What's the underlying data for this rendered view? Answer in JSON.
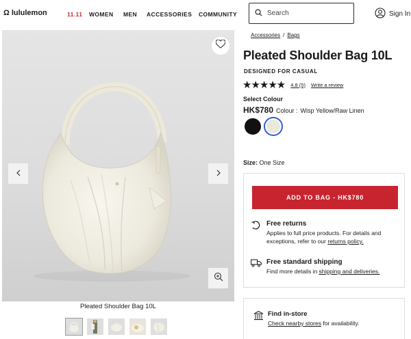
{
  "header": {
    "logo_text": "lululemon",
    "nav": [
      "11.11",
      "WOMEN",
      "MEN",
      "ACCESSORIES",
      "COMMUNITY"
    ],
    "search_placeholder": "Search",
    "signin_label": "Sign In"
  },
  "gallery": {
    "caption": "Pleated Shoulder Bag 10L",
    "thumbnail_count": 5
  },
  "breadcrumb": [
    "Accessories",
    "/",
    "Bags"
  ],
  "product": {
    "title": "Pleated Shoulder Bag 10L",
    "subtitle": "DESIGNED FOR CASUAL",
    "stars": "★★★★★",
    "rating_value": "4.8",
    "review_count": "(5)",
    "write_review": "Write a review",
    "select_colour_label": "Select Colour",
    "price": "HK$780",
    "colour_label": "Colour :",
    "colour_value": "Wisp Yellow/Raw Linen",
    "swatches": [
      {
        "name": "Black",
        "color": "#111111"
      },
      {
        "name": "Wisp Yellow/Raw Linen",
        "color": "#EBE8DC",
        "selected": true
      }
    ],
    "size_label": "Size:",
    "size_value": "One Size"
  },
  "buy": {
    "add_to_bag": "ADD TO BAG - HK$780",
    "accent_color": "#C8242F",
    "returns_title": "Free returns",
    "returns_text": "Applies to full price products. For details and exceptions, refer to our",
    "returns_link": "returns policy.",
    "shipping_title": "Free standard shipping",
    "shipping_text": "Find more details in",
    "shipping_link": "shipping and deliveries."
  },
  "store": {
    "title": "Find in-store",
    "link": "Check nearby stores",
    "text": "for availability."
  }
}
